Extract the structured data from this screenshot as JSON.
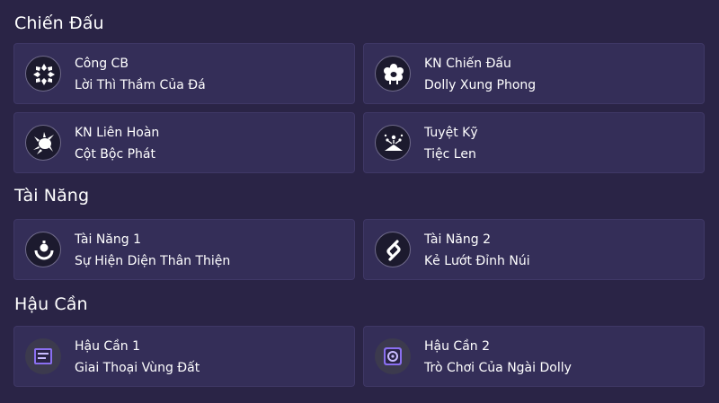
{
  "sections": [
    {
      "title": "Chiến Đấu"
    },
    {
      "title": "Tài Năng"
    },
    {
      "title": "Hậu Cần"
    }
  ],
  "cards": [
    {
      "title": "Công CB",
      "subtitle": "Lời Thì Thầm Của Đá",
      "icon": "crystal-x-icon"
    },
    {
      "title": "KN Chiến Đấu",
      "subtitle": "Dolly Xung Phong",
      "icon": "sheep-icon"
    },
    {
      "title": "KN Liên Hoàn",
      "subtitle": "Cột Bộc Phát",
      "icon": "burst-icon"
    },
    {
      "title": "Tuyệt Kỹ",
      "subtitle": "Tiệc Len",
      "icon": "fireworks-icon"
    },
    {
      "title": "Tài Năng 1",
      "subtitle": "Sự Hiện Diện Thân Thiện",
      "icon": "presence-icon"
    },
    {
      "title": "Tài Năng 2",
      "subtitle": "Kẻ Lướt Đỉnh Núi",
      "icon": "swirl-icon"
    },
    {
      "title": "Hậu Cần 1",
      "subtitle": "Giai Thoại Vùng Đất",
      "icon": "scroll-icon"
    },
    {
      "title": "Hậu Cần 2",
      "subtitle": "Trò Chơi Của Ngài Dolly",
      "icon": "dice-icon"
    }
  ],
  "colors": {
    "background": "#2a2446",
    "card": "#342e58",
    "accent_purple": "#8a6ff0"
  }
}
